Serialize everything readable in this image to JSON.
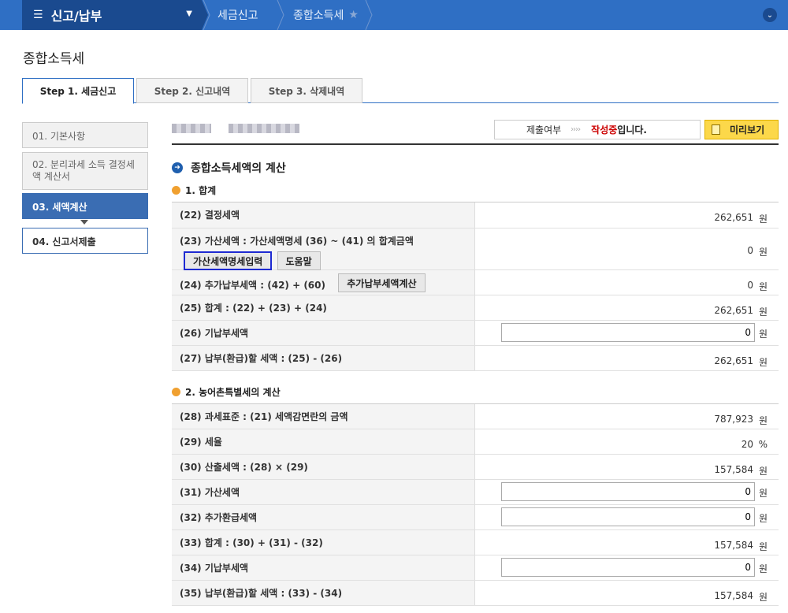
{
  "topbar": {
    "menu_label": "신고/납부",
    "crumb1": "세금신고",
    "crumb2": "종합소득세"
  },
  "page_title": "종합소득세",
  "tabs": [
    {
      "label": "Step 1. 세금신고"
    },
    {
      "label": "Step 2. 신고내역"
    },
    {
      "label": "Step 3. 삭제내역"
    }
  ],
  "sidebar": [
    {
      "label": "01. 기본사항"
    },
    {
      "label": "02. 분리과세 소득 결정세액 계산서"
    },
    {
      "label": "03. 세액계산"
    },
    {
      "label": "04. 신고서제출"
    }
  ],
  "status": {
    "label": "제출여부",
    "arrows": "››››",
    "value": "작성중",
    "suffix": "입니다.",
    "preview": "미리보기"
  },
  "section_title": "종합소득세액의 계산",
  "group1": {
    "title": "1. 합계",
    "rows": [
      {
        "label": "(22) 결정세액",
        "value": "262,651",
        "unit": "원"
      },
      {
        "label": "(23) 가산세액 : 가산세액명세 (36) ~ (41) 의 합계금액",
        "value": "0",
        "unit": "원",
        "btn1": "가산세액명세입력",
        "btn2": "도움말"
      },
      {
        "label": "(24) 추가납부세액 : (42) + (60)",
        "value": "0",
        "unit": "원",
        "btn": "추가납부세액계산"
      },
      {
        "label": "(25) 합계 : (22) + (23) + (24)",
        "value": "262,651",
        "unit": "원"
      },
      {
        "label": "(26) 기납부세액",
        "value": "0",
        "unit": "원"
      },
      {
        "label": "(27) 납부(환급)할 세액 : (25) - (26)",
        "value": "262,651",
        "unit": "원"
      }
    ]
  },
  "group2": {
    "title": "2. 농어촌특별세의 계산",
    "rows": [
      {
        "label": "(28) 과세표준 : (21) 세액감면란의 금액",
        "value": "787,923",
        "unit": "원"
      },
      {
        "label": "(29) 세율",
        "value": "20",
        "unit": "%"
      },
      {
        "label": "(30) 산출세액 : (28) × (29)",
        "value": "157,584",
        "unit": "원"
      },
      {
        "label": "(31) 가산세액",
        "value": "0",
        "unit": "원"
      },
      {
        "label": "(32) 추가환급세액",
        "value": "0",
        "unit": "원"
      },
      {
        "label": "(33) 합계 : (30) + (31) - (32)",
        "value": "157,584",
        "unit": "원"
      },
      {
        "label": "(34) 기납부세액",
        "value": "0",
        "unit": "원"
      },
      {
        "label": "(35) 납부(환급)할 세액 : (33) - (34)",
        "value": "157,584",
        "unit": "원"
      }
    ]
  }
}
